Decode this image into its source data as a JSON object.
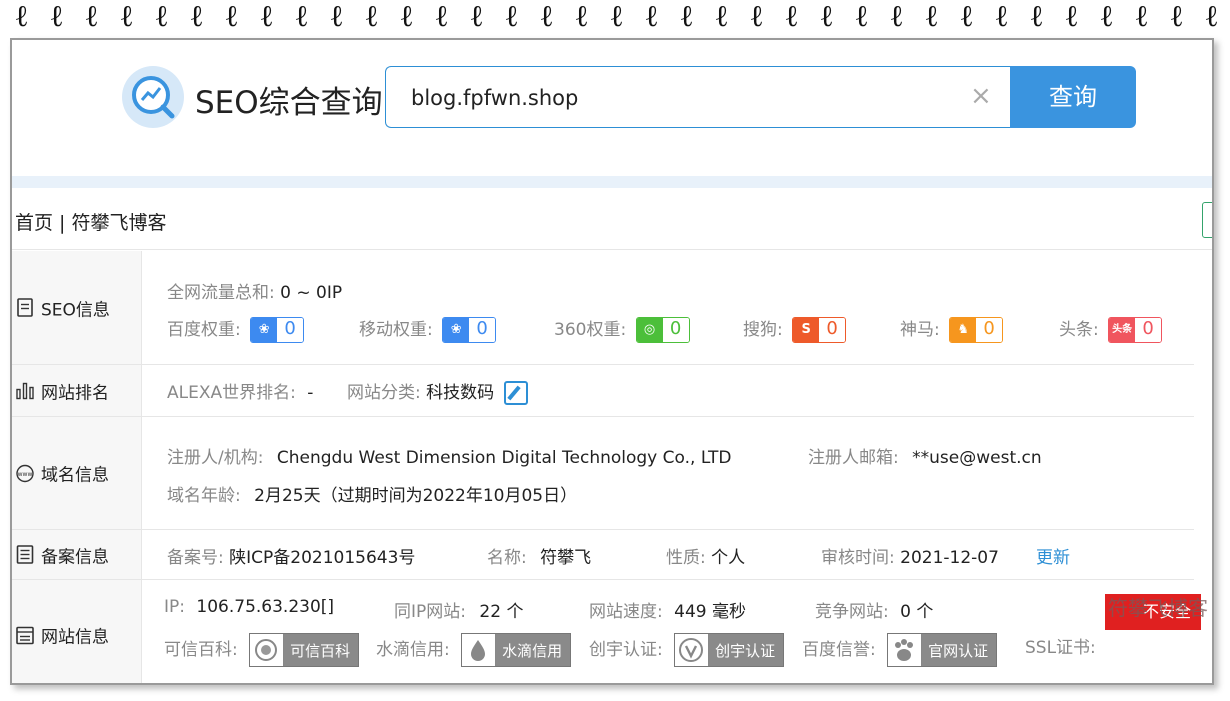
{
  "header": {
    "logo_title": "SEO综合查询",
    "search_value": "blog.fpfwn.shop",
    "search_button": "查询",
    "clear_symbol": "×"
  },
  "page_title": "首页 | 符攀飞博客",
  "seo": {
    "label": "SEO信息",
    "traffic_label": "全网流量总和:",
    "traffic_value": "0 ~ 0IP",
    "weights": [
      {
        "label": "百度权重:",
        "value": "0",
        "icon": "baidu-paw-icon",
        "color": "#3d8af0"
      },
      {
        "label": "移动权重:",
        "value": "0",
        "icon": "baidu-paw-icon",
        "color": "#3d8af0"
      },
      {
        "label": "360权重:",
        "value": "0",
        "icon": "360-icon",
        "color": "#4cbf3a"
      },
      {
        "label": "搜狗:",
        "value": "0",
        "icon": "sogou-icon",
        "color": "#ee5a2a"
      },
      {
        "label": "神马:",
        "value": "0",
        "icon": "shenma-icon",
        "color": "#f6961e"
      },
      {
        "label": "头条:",
        "value": "0",
        "icon": "toutiao-icon",
        "color": "#f0555e"
      }
    ]
  },
  "rank": {
    "label": "网站排名",
    "alexa_label": "ALEXA世界排名:",
    "alexa_value": "-",
    "category_label": "网站分类:",
    "category_value": "科技数码"
  },
  "domain": {
    "label": "域名信息",
    "registrant_label": "注册人/机构:",
    "registrant_value": "Chengdu West Dimension Digital Technology Co., LTD",
    "email_label": "注册人邮箱:",
    "email_value": "**use@west.cn",
    "age_label": "域名年龄:",
    "age_value": "2月25天（过期时间为2022年10月05日）"
  },
  "icp": {
    "label": "备案信息",
    "number_label": "备案号:",
    "number_value": "陕ICP备2021015643号",
    "name_label": "名称:",
    "name_value": "符攀飞",
    "type_label": "性质:",
    "type_value": "个人",
    "review_label": "审核时间:",
    "review_value": "2021-12-07",
    "update_link": "更新"
  },
  "site": {
    "label": "网站信息",
    "ip_label": "IP:",
    "ip_value": "106.75.63.230[]",
    "same_ip_label": "同IP网站:",
    "same_ip_value": "22 个",
    "speed_label": "网站速度:",
    "speed_value": "449 毫秒",
    "competitor_label": "竞争网站:",
    "competitor_value": "0 个",
    "certs": [
      {
        "label": "可信百科:",
        "badge": "可信百科"
      },
      {
        "label": "水滴信用:",
        "badge": "水滴信用"
      },
      {
        "label": "创宇认证:",
        "badge": "创宇认证"
      },
      {
        "label": "百度信誉:",
        "badge": "官网认证"
      }
    ],
    "ssl_label": "SSL证书:",
    "ssl_value": "不安全"
  },
  "watermark": "符攀飞博客",
  "colors": {
    "accent": "#3a94df",
    "band": "#e8f1fa",
    "unsafe": "#e02020"
  }
}
